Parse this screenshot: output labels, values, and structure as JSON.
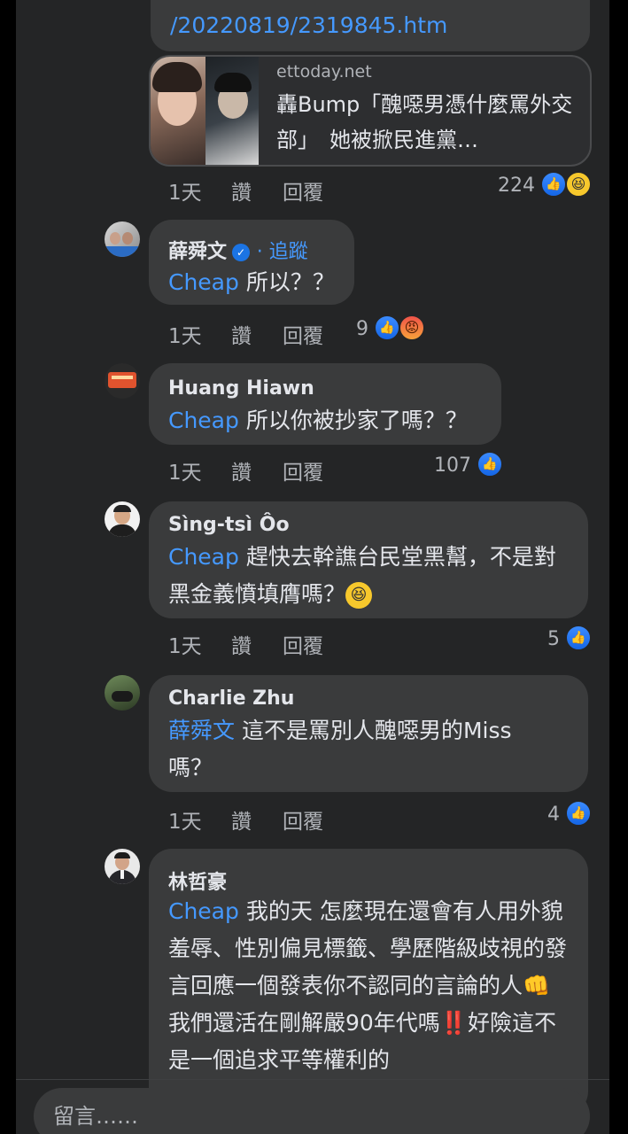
{
  "link_preview": {
    "url_tail": "/20220819/2319845.htm",
    "domain": "ettoday.net",
    "title": "轟Bump「醜噁男憑什麼罵外交部」　她被掀民進黨…"
  },
  "root_meta": {
    "time": "1天",
    "like": "讚",
    "reply": "回覆",
    "reaction_count": "224"
  },
  "comments": [
    {
      "author": "薛舜文",
      "follow_label": "· 追蹤",
      "mention": "Cheap",
      "text": " 所以？？",
      "time": "1天",
      "like": "讚",
      "reply": "回覆",
      "reaction_count": "9"
    },
    {
      "author": "Huang Hiawn",
      "mention": "Cheap",
      "text": " 所以你被抄家了嗎？？",
      "time": "1天",
      "like": "讚",
      "reply": "回覆",
      "reaction_count": "107"
    },
    {
      "author": "Sìng-tsì Ôo",
      "mention": "Cheap",
      "text": " 趕快去幹譙台民堂黑幫，不是對黑金義憤填膺嗎？",
      "time": "1天",
      "like": "讚",
      "reply": "回覆",
      "reaction_count": "5"
    },
    {
      "author": "Charlie Zhu",
      "mention": "薛舜文",
      "text": " 這不是罵別人醜噁男的Miss嗎？",
      "time": "1天",
      "like": "讚",
      "reply": "回覆",
      "reaction_count": "4"
    },
    {
      "author": "林哲豪",
      "mention": "Cheap",
      "text": " 我的天 怎麼現在還會有人用外貌羞辱、性別偏見標籤、學歷階級歧視的發言回應一個發表你不認同的言論的人👊我們還活在剛解嚴90年代嗎‼️好險這不是一個追求平等權利的"
    }
  ],
  "composer": {
    "placeholder": "留言……"
  },
  "colors": {
    "background": "#242526",
    "bubble": "#3a3b3c",
    "mention": "#4599ff",
    "like_blue": "#1b74e4"
  },
  "icons": [
    "like-icon",
    "haha-icon",
    "angry-icon",
    "verified-badge-icon"
  ]
}
